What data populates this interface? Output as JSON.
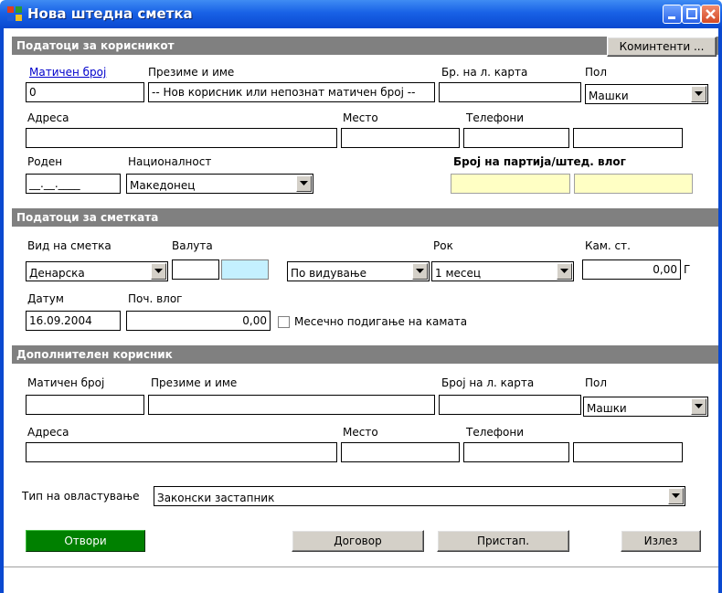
{
  "window": {
    "title": "Нова штедна сметка"
  },
  "sections": {
    "client": "Податоци за корисникот",
    "account": "Податоци за сметката",
    "additional": "Дополнителен корисник"
  },
  "buttons": {
    "komintenti": "Коминтенти ...",
    "open": "Отвори",
    "contract": "Договор",
    "access": "Пристап.",
    "exit": "Излез"
  },
  "colors": {
    "title": "#0a49d0",
    "section": "#808080",
    "open_button": "#008000",
    "highlight": "#ffffc4"
  },
  "client": {
    "labels": {
      "embg": "Матичен број",
      "name": "Презиме и име",
      "id_card": "Бр. на л. карта",
      "gender": "Пол",
      "address": "Адреса",
      "place": "Место",
      "phones": "Телефони",
      "born": "Роден",
      "nationality": "Националност",
      "party": "Број на партија/штед. влог"
    },
    "values": {
      "embg": "0",
      "name": "-- Нов корисник или непознат матичен број --",
      "id_card": "",
      "gender": "Машки",
      "address": "",
      "place": "",
      "phone1": "",
      "phone2": "",
      "born": "__.__.____",
      "nationality": "Македонец",
      "party1": "",
      "party2": ""
    }
  },
  "account": {
    "labels": {
      "type": "Вид на сметка",
      "currency": "Валута",
      "term": "Рок",
      "rate": "Кам. ст.",
      "date": "Датум",
      "deposit": "Поч. влог",
      "monthly": "Месечно подигање на камата"
    },
    "values": {
      "type": "Денарска",
      "currency1": "",
      "currency2": "",
      "withdraw": "По видување",
      "term": "1 месец",
      "rate": "0,00",
      "rate_unit": "Г",
      "date": "16.09.2004",
      "deposit": "0,00",
      "monthly_checked": false
    }
  },
  "additional": {
    "labels": {
      "embg": "Матичен број",
      "name": "Презиме и име",
      "id_card": "Број на л. карта",
      "gender": "Пол",
      "address": "Адреса",
      "place": "Место",
      "phones": "Телефони",
      "authorization": "Тип на овластување"
    },
    "values": {
      "embg": "",
      "name": "",
      "id_card": "",
      "gender": "Машки",
      "address": "",
      "place": "",
      "phone1": "",
      "phone2": "",
      "authorization": "Законски застапник"
    }
  }
}
